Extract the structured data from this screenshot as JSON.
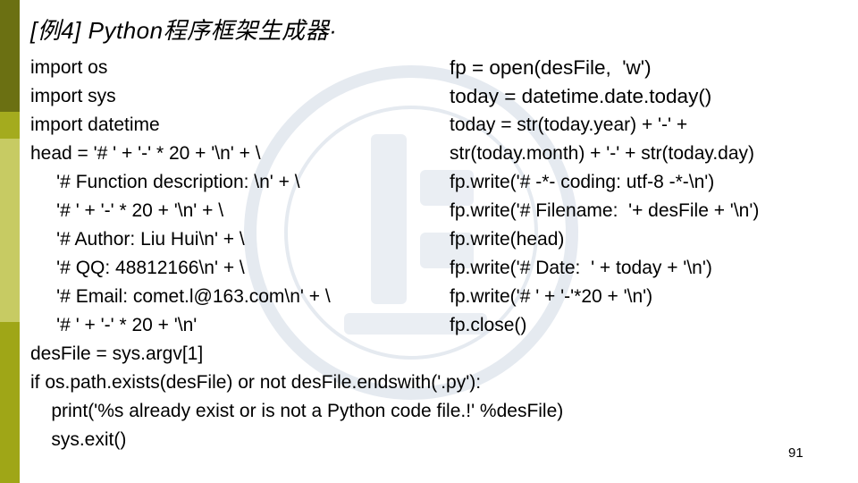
{
  "title": "[例4]  Python程序框架生成器·",
  "left_code": [
    "import os",
    "import sys",
    "import datetime",
    "head = '# ' + '-' * 20 + '\\n' + \\",
    "     '# Function description: \\n' + \\",
    "     '# ' + '-' * 20 + '\\n' + \\",
    "     '# Author: Liu Hui\\n' + \\",
    "     '# QQ: 48812166\\n' + \\",
    "     '# Email: comet.l@163.com\\n' + \\",
    "     '# ' + '-' * 20 + '\\n'",
    "desFile = sys.argv[1]",
    "if os.path.exists(desFile) or not desFile.endswith('.py'):",
    "    print('%s already exist or is not a Python code file.!' %desFile)",
    "    sys.exit()"
  ],
  "right_code": [
    "fp = open(desFile,  'w')",
    "today = datetime.date.today()",
    "today = str(today.year) + '-' +",
    "str(today.month) + '-' + str(today.day)",
    "fp.write('# -*- coding: utf-8 -*-\\n')",
    "fp.write('# Filename:  '+ desFile + '\\n')",
    "fp.write(head)",
    "fp.write('# Date:  ' + today + '\\n')",
    "fp.write('# ' + '-'*20 + '\\n')",
    "fp.close()"
  ],
  "page_number": "91",
  "colors": {
    "bar_dark": "#6b7012",
    "bar_mid": "#a4ab1e",
    "bar_light": "#c7cb63",
    "watermark": "#d9e0ea"
  }
}
